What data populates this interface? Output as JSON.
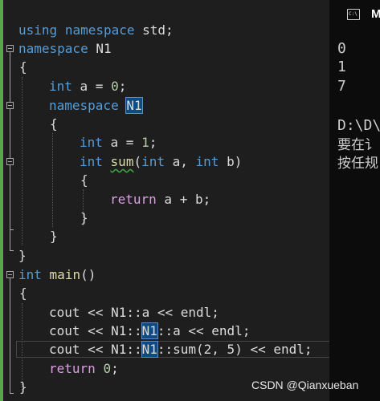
{
  "editor": {
    "lines": [
      {
        "tokens": [
          "using",
          " ",
          "namespace",
          " ",
          "std;"
        ]
      },
      {
        "tokens": [
          "namespace",
          " ",
          "N1"
        ]
      },
      {
        "tokens": [
          "{"
        ]
      },
      {
        "tokens": [
          "int",
          " a = ",
          "0",
          ";"
        ]
      },
      {
        "tokens": [
          "namespace",
          " ",
          "N1"
        ]
      },
      {
        "tokens": [
          "{"
        ]
      },
      {
        "tokens": [
          "int",
          " a = ",
          "1",
          ";"
        ]
      },
      {
        "tokens": [
          "int",
          " ",
          "sum",
          "(",
          "int",
          " a, ",
          "int",
          " b)"
        ]
      },
      {
        "tokens": [
          "{"
        ]
      },
      {
        "tokens": [
          "return",
          " a + b;"
        ]
      },
      {
        "tokens": [
          "}"
        ]
      },
      {
        "tokens": [
          "}"
        ]
      },
      {
        "tokens": [
          "}"
        ]
      },
      {
        "tokens": [
          "int",
          " ",
          "main",
          "()"
        ]
      },
      {
        "tokens": [
          "{"
        ]
      },
      {
        "tokens": [
          "cout << N1::a << endl;"
        ]
      },
      {
        "tokens": [
          "cout << N1::",
          "N1",
          "::a << endl;"
        ]
      },
      {
        "tokens": [
          "cout << N1::",
          "N1",
          "::sum(2, 5) << endl;"
        ]
      },
      {
        "tokens": [
          "return",
          " ",
          "0",
          ";"
        ]
      },
      {
        "tokens": [
          "}"
        ]
      }
    ]
  },
  "console": {
    "icon_text": "C:\\",
    "title": "M",
    "output": [
      "0",
      "1",
      "7",
      "",
      "D:\\D\\",
      "要在讠",
      "按任规"
    ]
  },
  "watermark": "CSDN @Qianxueban",
  "colors": {
    "background": "#1e1e1e",
    "keyword": "#569cd6",
    "function": "#dcdcaa",
    "number": "#b5cea8",
    "control_keyword": "#d8a0df",
    "change_bar": "#57a64a",
    "console_background": "#0c0c0c"
  }
}
